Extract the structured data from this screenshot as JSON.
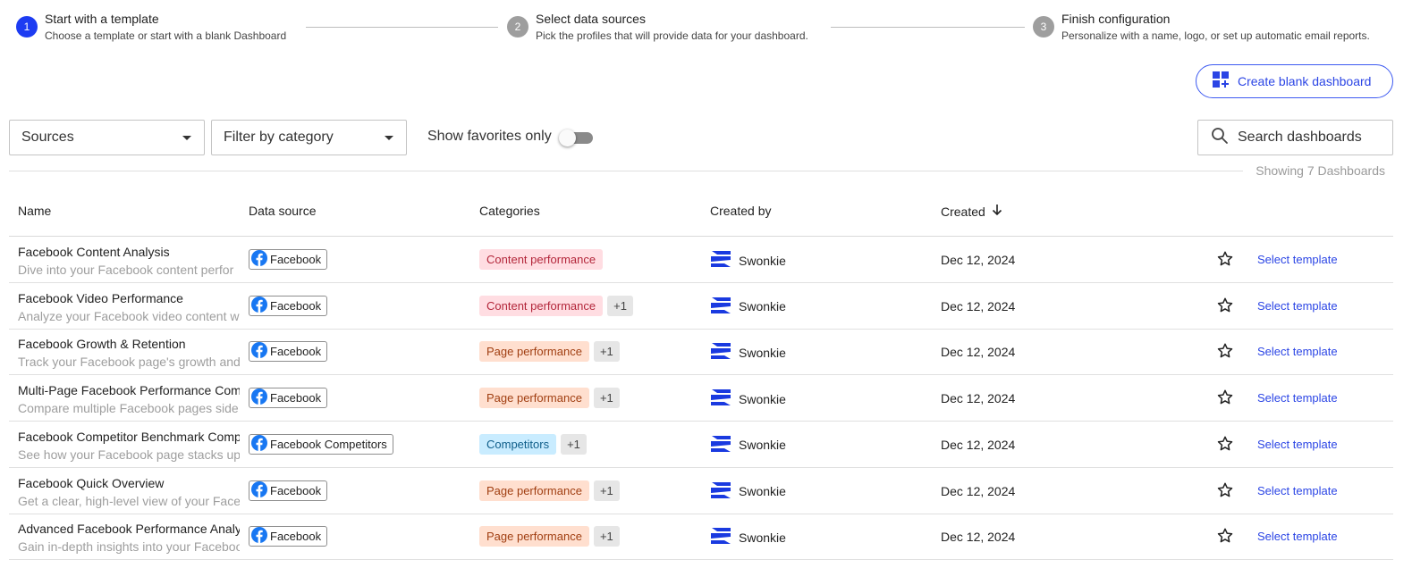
{
  "stepper": {
    "steps": [
      {
        "number": "1",
        "title": "Start with a template",
        "subtitle": "Choose a template or start with a blank Dashboard"
      },
      {
        "number": "2",
        "title": "Select data sources",
        "subtitle": "Pick the profiles that will provide data for your dashboard."
      },
      {
        "number": "3",
        "title": "Finish configuration",
        "subtitle": "Personalize with a name, logo, or set up automatic email reports."
      }
    ]
  },
  "toolbar": {
    "create_label": "Create blank dashboard",
    "sources_label": "Sources",
    "category_label": "Filter by category",
    "favorites_label": "Show favorites only",
    "favorites_on": false,
    "search_placeholder": "Search dashboards",
    "showing_text": "Showing 7 Dashboards"
  },
  "table": {
    "columns": {
      "name": "Name",
      "source": "Data source",
      "categories": "Categories",
      "created_by": "Created by",
      "created": "Created"
    },
    "select_label": "Select template",
    "rows": [
      {
        "title": "Facebook Content Analysis",
        "desc": "Dive into your Facebook content perfor",
        "source": "Facebook",
        "category": "Content performance",
        "cat_style": "content",
        "more": "",
        "creator": "Swonkie",
        "created": "Dec 12, 2024"
      },
      {
        "title": "Facebook Video Performance",
        "desc": "Analyze your Facebook video content w",
        "source": "Facebook",
        "category": "Content performance",
        "cat_style": "content",
        "more": "+1",
        "creator": "Swonkie",
        "created": "Dec 12, 2024"
      },
      {
        "title": "Facebook Growth & Retention",
        "desc": "Track your Facebook page's growth and",
        "source": "Facebook",
        "category": "Page performance",
        "cat_style": "page",
        "more": "+1",
        "creator": "Swonkie",
        "created": "Dec 12, 2024"
      },
      {
        "title": "Multi-Page Facebook Performance Com",
        "desc": "Compare multiple Facebook pages side",
        "source": "Facebook",
        "category": "Page performance",
        "cat_style": "page",
        "more": "+1",
        "creator": "Swonkie",
        "created": "Dec 12, 2024"
      },
      {
        "title": "Facebook Competitor Benchmark Comp",
        "desc": "See how your Facebook page stacks up",
        "source": "Facebook Competitors",
        "category": "Competitors",
        "cat_style": "competitors",
        "more": "+1",
        "creator": "Swonkie",
        "created": "Dec 12, 2024"
      },
      {
        "title": "Facebook Quick Overview",
        "desc": "Get a clear, high-level view of your Face",
        "source": "Facebook",
        "category": "Page performance",
        "cat_style": "page",
        "more": "+1",
        "creator": "Swonkie",
        "created": "Dec 12, 2024"
      },
      {
        "title": "Advanced Facebook Performance Analy",
        "desc": "Gain in-depth insights into your Faceboo",
        "source": "Facebook",
        "category": "Page performance",
        "cat_style": "page",
        "more": "+1",
        "creator": "Swonkie",
        "created": "Dec 12, 2024"
      }
    ]
  },
  "colors": {
    "accent": "#2b45e5",
    "step_active": "#1d3cf2",
    "step_inactive": "#9e9e9e",
    "facebook": "#1877f2",
    "swonkie": "#1a3ae0"
  },
  "icons": {
    "create": "dashboard-add-icon",
    "search": "search-icon",
    "sort": "arrow-down-icon",
    "favorite": "star-outline-icon",
    "source": "facebook-icon",
    "creator": "swonkie-logo-icon"
  }
}
